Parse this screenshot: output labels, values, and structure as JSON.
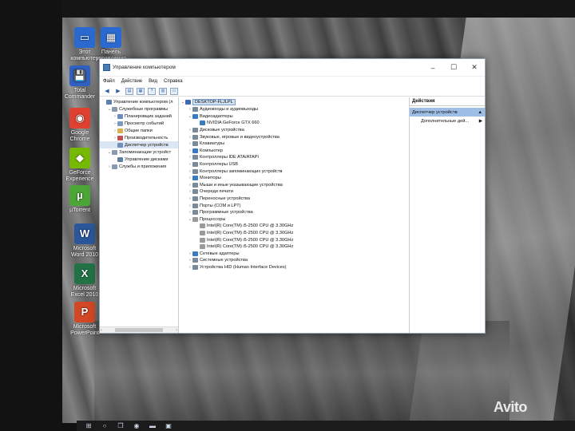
{
  "desktop_icons": [
    {
      "label": "Этот компьютер",
      "icon": "computer-icon",
      "color": "#2a6ad0"
    },
    {
      "label": "Панель управления",
      "icon": "control-panel-icon",
      "color": "#2a6ad0"
    },
    {
      "label": "Total Commander",
      "icon": "total-commander-icon",
      "color": "#3060c0"
    },
    {
      "label": "Google Chrome",
      "icon": "chrome-icon",
      "color": "#e04030"
    },
    {
      "label": "GeForce Experience",
      "icon": "geforce-icon",
      "color": "#76b900"
    },
    {
      "label": "µTorrent",
      "icon": "utorrent-icon",
      "color": "#4ca637"
    },
    {
      "label": "Microsoft Word 2010",
      "icon": "word-icon",
      "color": "#2b579a"
    },
    {
      "label": "Microsoft Excel 2010",
      "icon": "excel-icon",
      "color": "#217346"
    },
    {
      "label": "Microsoft PowerPoint",
      "icon": "powerpoint-icon",
      "color": "#d24726"
    }
  ],
  "window": {
    "title": "Управление компьютером",
    "menu": [
      "Файл",
      "Действие",
      "Вид",
      "Справка"
    ],
    "tree": [
      {
        "label": "Управление компьютером (л",
        "level": 0,
        "tw": "",
        "icon_color": "#5a7fb0"
      },
      {
        "label": "Служебные программы",
        "level": 1,
        "tw": "⌄",
        "icon_color": "#8a9bb0"
      },
      {
        "label": "Планировщик заданий",
        "level": 2,
        "tw": "›",
        "icon_color": "#6a8cc0"
      },
      {
        "label": "Просмотр событий",
        "level": 2,
        "tw": "›",
        "icon_color": "#7a9ac0"
      },
      {
        "label": "Общие папки",
        "level": 2,
        "tw": "›",
        "icon_color": "#d8b04a"
      },
      {
        "label": "Производительность",
        "level": 2,
        "tw": "›",
        "icon_color": "#c05050"
      },
      {
        "label": "Диспетчер устройств",
        "level": 2,
        "tw": "",
        "icon_color": "#7090b8",
        "selected": true
      },
      {
        "label": "Запоминающие устройст",
        "level": 1,
        "tw": "⌄",
        "icon_color": "#8a9bb0"
      },
      {
        "label": "Управление дисками",
        "level": 2,
        "tw": "",
        "icon_color": "#6080a8"
      },
      {
        "label": "Службы и приложения",
        "level": 1,
        "tw": "›",
        "icon_color": "#8a9bb0"
      }
    ],
    "devices": [
      {
        "label": "DESKTOP-FLJLPL",
        "level": 0,
        "tw": "⌄",
        "icon_color": "#3a6ab0",
        "root": true
      },
      {
        "label": "Аудиовходы и аудиовыходы",
        "level": 1,
        "tw": "›",
        "icon_color": "#7a8a9a"
      },
      {
        "label": "Видеоадаптеры",
        "level": 1,
        "tw": "⌄",
        "icon_color": "#3a7ac0"
      },
      {
        "label": "NVIDIA GeForce GTX 660",
        "level": 2,
        "tw": "",
        "icon_color": "#3a7ac0"
      },
      {
        "label": "Дисковые устройства",
        "level": 1,
        "tw": "›",
        "icon_color": "#7a8a9a"
      },
      {
        "label": "Звуковые, игровые и видеоустройства",
        "level": 1,
        "tw": "›",
        "icon_color": "#7a8a9a"
      },
      {
        "label": "Клавиатуры",
        "level": 1,
        "tw": "›",
        "icon_color": "#7a8a9a"
      },
      {
        "label": "Компьютер",
        "level": 1,
        "tw": "›",
        "icon_color": "#3a7ac0"
      },
      {
        "label": "Контроллеры IDE ATA/ATAPI",
        "level": 1,
        "tw": "›",
        "icon_color": "#7a8a9a"
      },
      {
        "label": "Контроллеры USB",
        "level": 1,
        "tw": "›",
        "icon_color": "#7a8a9a"
      },
      {
        "label": "Контроллеры запоминающих устройств",
        "level": 1,
        "tw": "›",
        "icon_color": "#7a8a9a"
      },
      {
        "label": "Мониторы",
        "level": 1,
        "tw": "›",
        "icon_color": "#3a7ac0"
      },
      {
        "label": "Мыши и иные указывающие устройства",
        "level": 1,
        "tw": "›",
        "icon_color": "#7a8a9a"
      },
      {
        "label": "Очереди печати",
        "level": 1,
        "tw": "›",
        "icon_color": "#7a8a9a"
      },
      {
        "label": "Переносные устройства",
        "level": 1,
        "tw": "›",
        "icon_color": "#7a8a9a"
      },
      {
        "label": "Порты (COM и LPT)",
        "level": 1,
        "tw": "›",
        "icon_color": "#7a8a9a"
      },
      {
        "label": "Программные устройства",
        "level": 1,
        "tw": "›",
        "icon_color": "#7a8a9a"
      },
      {
        "label": "Процессоры",
        "level": 1,
        "tw": "⌄",
        "icon_color": "#9a9a9a"
      },
      {
        "label": "Intel(R) Core(TM) i5-2500 CPU @ 3.30GHz",
        "level": 2,
        "tw": "",
        "icon_color": "#9a9a9a"
      },
      {
        "label": "Intel(R) Core(TM) i5-2500 CPU @ 3.30GHz",
        "level": 2,
        "tw": "",
        "icon_color": "#9a9a9a"
      },
      {
        "label": "Intel(R) Core(TM) i5-2500 CPU @ 3.30GHz",
        "level": 2,
        "tw": "",
        "icon_color": "#9a9a9a"
      },
      {
        "label": "Intel(R) Core(TM) i5-2500 CPU @ 3.30GHz",
        "level": 2,
        "tw": "",
        "icon_color": "#9a9a9a"
      },
      {
        "label": "Сетевые адаптеры",
        "level": 1,
        "tw": "›",
        "icon_color": "#3a7ac0"
      },
      {
        "label": "Системные устройства",
        "level": 1,
        "tw": "›",
        "icon_color": "#7a8a9a"
      },
      {
        "label": "Устройства HID (Human Interface Devices)",
        "level": 1,
        "tw": "›",
        "icon_color": "#7a8a9a"
      }
    ],
    "actions": {
      "header": "Действия",
      "selected": "Диспетчер устройств",
      "more": "Дополнительные дей..."
    }
  },
  "taskbar": {
    "items": [
      "windows-start-icon",
      "search-icon",
      "task-view-icon",
      "chrome-taskbar-icon",
      "explorer-taskbar-icon",
      "computer-management-taskbar-icon"
    ]
  },
  "watermark": "Avito"
}
